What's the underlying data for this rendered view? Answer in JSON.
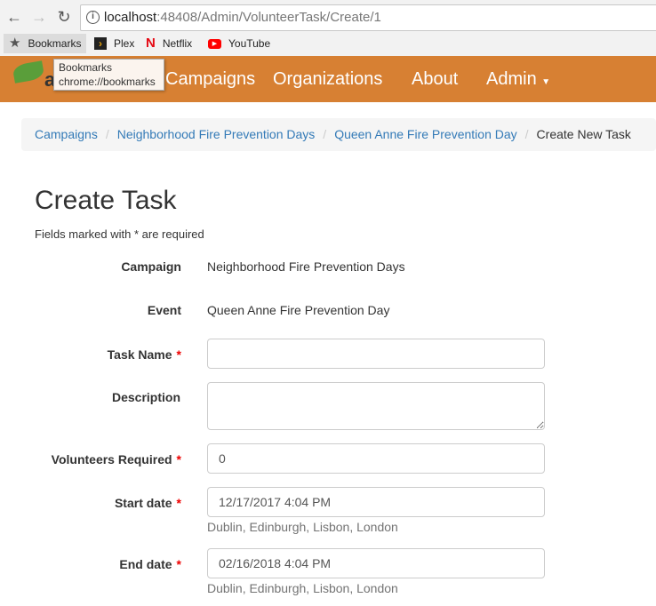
{
  "browser": {
    "url_host": "localhost",
    "url_path": ":48408/Admin/VolunteerTask/Create/1",
    "bookmarks": [
      {
        "label": "Bookmarks",
        "icon": "star-icon"
      },
      {
        "label": "Plex",
        "icon": "plex-icon"
      },
      {
        "label": "Netflix",
        "icon": "netflix-icon"
      },
      {
        "label": "YouTube",
        "icon": "youtube-icon"
      }
    ],
    "tooltip": {
      "title": "Bookmarks",
      "url": "chrome://bookmarks"
    }
  },
  "nav": {
    "brand": "allReady",
    "items": [
      "Campaigns",
      "Organizations",
      "About",
      "Admin"
    ],
    "color": "#d78033"
  },
  "breadcrumb": [
    "Campaigns",
    "Neighborhood Fire Prevention Days",
    "Queen Anne Fire Prevention Day",
    "Create New Task"
  ],
  "page": {
    "title": "Create Task",
    "note": "Fields marked with * are required"
  },
  "form": {
    "campaign_label": "Campaign",
    "campaign_value": "Neighborhood Fire Prevention Days",
    "event_label": "Event",
    "event_value": "Queen Anne Fire Prevention Day",
    "task_name_label": "Task Name",
    "task_name_value": "",
    "description_label": "Description",
    "description_value": "",
    "volunteers_label": "Volunteers Required",
    "volunteers_value": "0",
    "start_label": "Start date",
    "start_value": "12/17/2017 4:04 PM",
    "start_tz": "Dublin, Edinburgh, Lisbon, London",
    "end_label": "End date",
    "end_value": "02/16/2018 4:04 PM",
    "end_tz": "Dublin, Edinburgh, Lisbon, London",
    "required_mark": "*"
  }
}
